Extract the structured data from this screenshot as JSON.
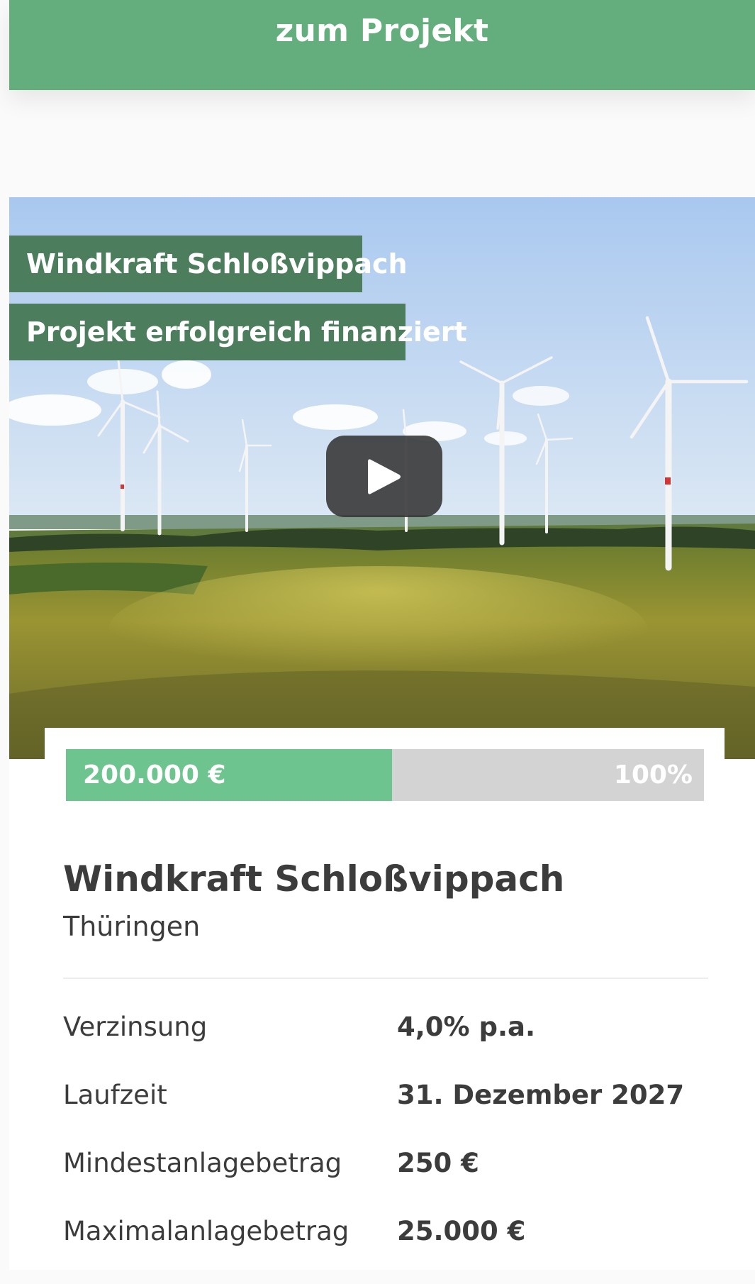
{
  "top_card": {
    "cta_label": "zum Projekt"
  },
  "project": {
    "name_tag": "Windkraft Schloßvippach",
    "status_tag": "Projekt erfolgreich finanziert",
    "video_play_icon": "play-icon",
    "funding": {
      "amount_label": "200.000 €",
      "percent_label": "100%",
      "fill_fraction": 1.0
    },
    "title": "Windkraft Schloßvippach",
    "region": "Thüringen",
    "facts": [
      {
        "label": "Verzinsung",
        "value": "4,0% p.a."
      },
      {
        "label": "Laufzeit",
        "value": "31. Dezember 2027"
      },
      {
        "label": "Mindestanlagebetrag",
        "value": "250 €"
      },
      {
        "label": "Maximalanlagebetrag",
        "value": "25.000 €"
      }
    ]
  },
  "colors": {
    "brand_green": "#64ad7c",
    "tag_green": "#4c7e5d",
    "progress_green": "#6dc48e",
    "progress_track": "#d3d3d3"
  }
}
